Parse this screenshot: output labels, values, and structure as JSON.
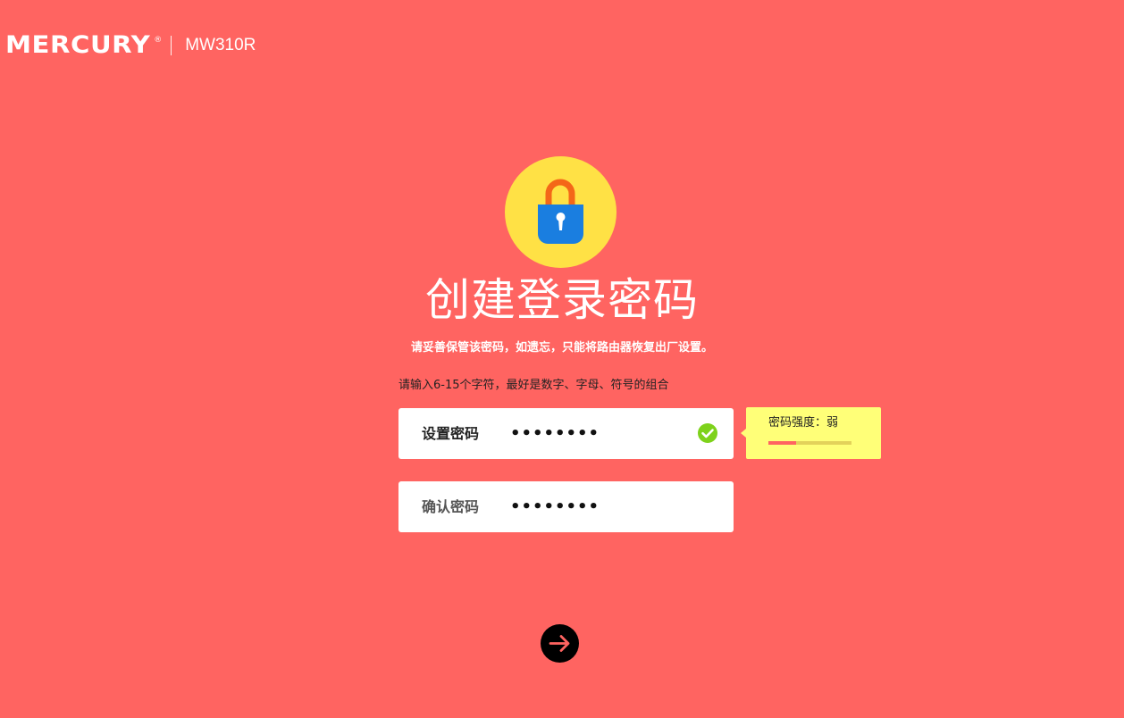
{
  "header": {
    "brand": "MERCURY",
    "brand_mark": "®",
    "model": "MW310R"
  },
  "main": {
    "icon": "lock-icon",
    "title": "创建登录密码",
    "warning": "请妥善保管该密码，如遗忘，只能将路由器恢复出厂设置。",
    "hint": "请输入6-15个字符，最好是数字、字母、符号的组合"
  },
  "form": {
    "password": {
      "label": "设置密码",
      "value": "••••••••",
      "status_icon": "check-circle-icon"
    },
    "confirm": {
      "label": "确认密码",
      "value": "••••••••"
    }
  },
  "strength": {
    "label": "密码强度：弱",
    "level": 0.33
  },
  "next_button": {
    "icon": "arrow-right-icon"
  },
  "colors": {
    "background": "#ff6461",
    "lock_circle": "#ffe145",
    "lock_body": "#1a7ee0",
    "lock_shackle": "#f46718",
    "check": "#7ed21b",
    "tooltip": "#ffff78"
  }
}
